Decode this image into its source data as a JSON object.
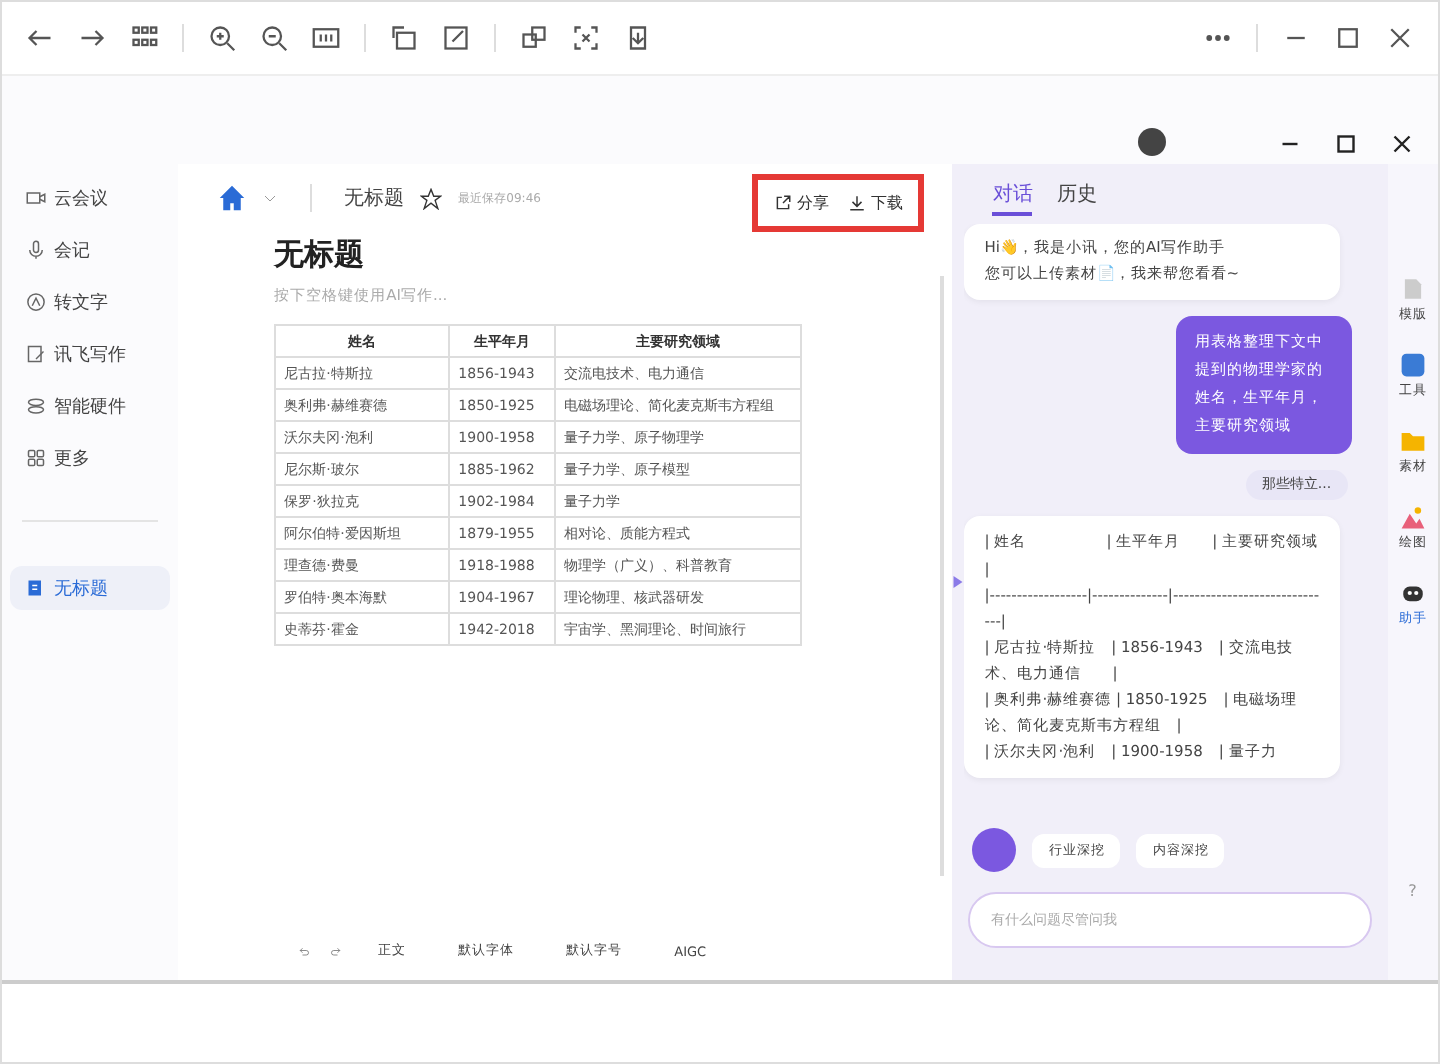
{
  "sidebar": {
    "items": [
      {
        "label": "云会议",
        "kind": "video",
        "selected": false
      },
      {
        "label": "会记",
        "kind": "mic",
        "selected": false
      },
      {
        "label": "转文字",
        "kind": "text",
        "selected": false
      },
      {
        "label": "讯飞写作",
        "kind": "write",
        "selected": false
      },
      {
        "label": "智能硬件",
        "kind": "device",
        "selected": false
      },
      {
        "label": "更多",
        "kind": "grid",
        "selected": false
      }
    ],
    "documents": [
      {
        "label": "无标题",
        "selected": true
      }
    ]
  },
  "document": {
    "breadcrumb_title": "无标题",
    "starred": false,
    "save_status": "最近保存09:46",
    "actions": [
      {
        "label": "分享",
        "kind": "share"
      },
      {
        "label": "下载",
        "kind": "download"
      }
    ],
    "actions_highlighted": true,
    "heading": "无标题",
    "placeholder": "按下空格键使用AI写作...",
    "table": {
      "columns": [
        "姓名",
        "生平年月",
        "主要研究领域"
      ],
      "rows": [
        [
          "尼古拉·特斯拉",
          "1856-1943",
          "交流电技术、电力通信"
        ],
        [
          "奥利弗·赫维赛德",
          "1850-1925",
          "电磁场理论、简化麦克斯韦方程组"
        ],
        [
          "沃尔夫冈·泡利",
          "1900-1958",
          "量子力学、原子物理学"
        ],
        [
          "尼尔斯·玻尔",
          "1885-1962",
          "量子力学、原子模型"
        ],
        [
          "保罗·狄拉克",
          "1902-1984",
          "量子力学"
        ],
        [
          "阿尔伯特·爱因斯坦",
          "1879-1955",
          "相对论、质能方程式"
        ],
        [
          "理查德·费曼",
          "1918-1988",
          "物理学（广义）、科普教育"
        ],
        [
          "罗伯特·奥本海默",
          "1904-1967",
          "理论物理、核武器研发"
        ],
        [
          "史蒂芬·霍金",
          "1942-2018",
          "宇宙学、黑洞理论、时间旅行"
        ]
      ]
    },
    "format_toolbar": {
      "style": "正文",
      "font": "默认字体",
      "size": "默认字号",
      "aigc": "AIGC"
    }
  },
  "assistant": {
    "tabs": [
      {
        "label": "对话",
        "selected": true
      },
      {
        "label": "历史",
        "selected": false
      }
    ],
    "messages": [
      {
        "kind": "bot",
        "lines": [
          "Hi👋，我是小讯，您的AI写作助手",
          "您可以上传素材📄，我来帮您看看~"
        ]
      },
      {
        "kind": "user",
        "lines": [
          "用表格整理下文中提到的物理学家的姓名，生平年月，主要研究领域"
        ]
      },
      {
        "kind": "attachment",
        "lines": [
          "那些特立..."
        ]
      },
      {
        "kind": "bot",
        "lines": [
          "| 姓名　　　　　| 生平年月　　| 主要研究领域　　　　|",
          "|------------------|--------------|------------------------------|",
          "| 尼古拉·特斯拉　| 1856-1943　| 交流电技术、电力通信　　|",
          "| 奥利弗·赫维赛德 | 1850-1925　| 电磁场理论、简化麦克斯韦方程组　|",
          "| 沃尔夫冈·泡利　| 1900-1958　| 量子力"
        ]
      }
    ],
    "chips": [
      "行业深挖",
      "内容深挖"
    ],
    "input_placeholder": "有什么问题尽管问我"
  },
  "rail": [
    {
      "label": "模版",
      "kind": "template",
      "selected": false
    },
    {
      "label": "工具",
      "kind": "ai",
      "selected": false
    },
    {
      "label": "素材",
      "kind": "folder",
      "selected": false
    },
    {
      "label": "绘图",
      "kind": "paint",
      "selected": false
    },
    {
      "label": "助手",
      "kind": "robot",
      "selected": true
    }
  ],
  "help": "?"
}
